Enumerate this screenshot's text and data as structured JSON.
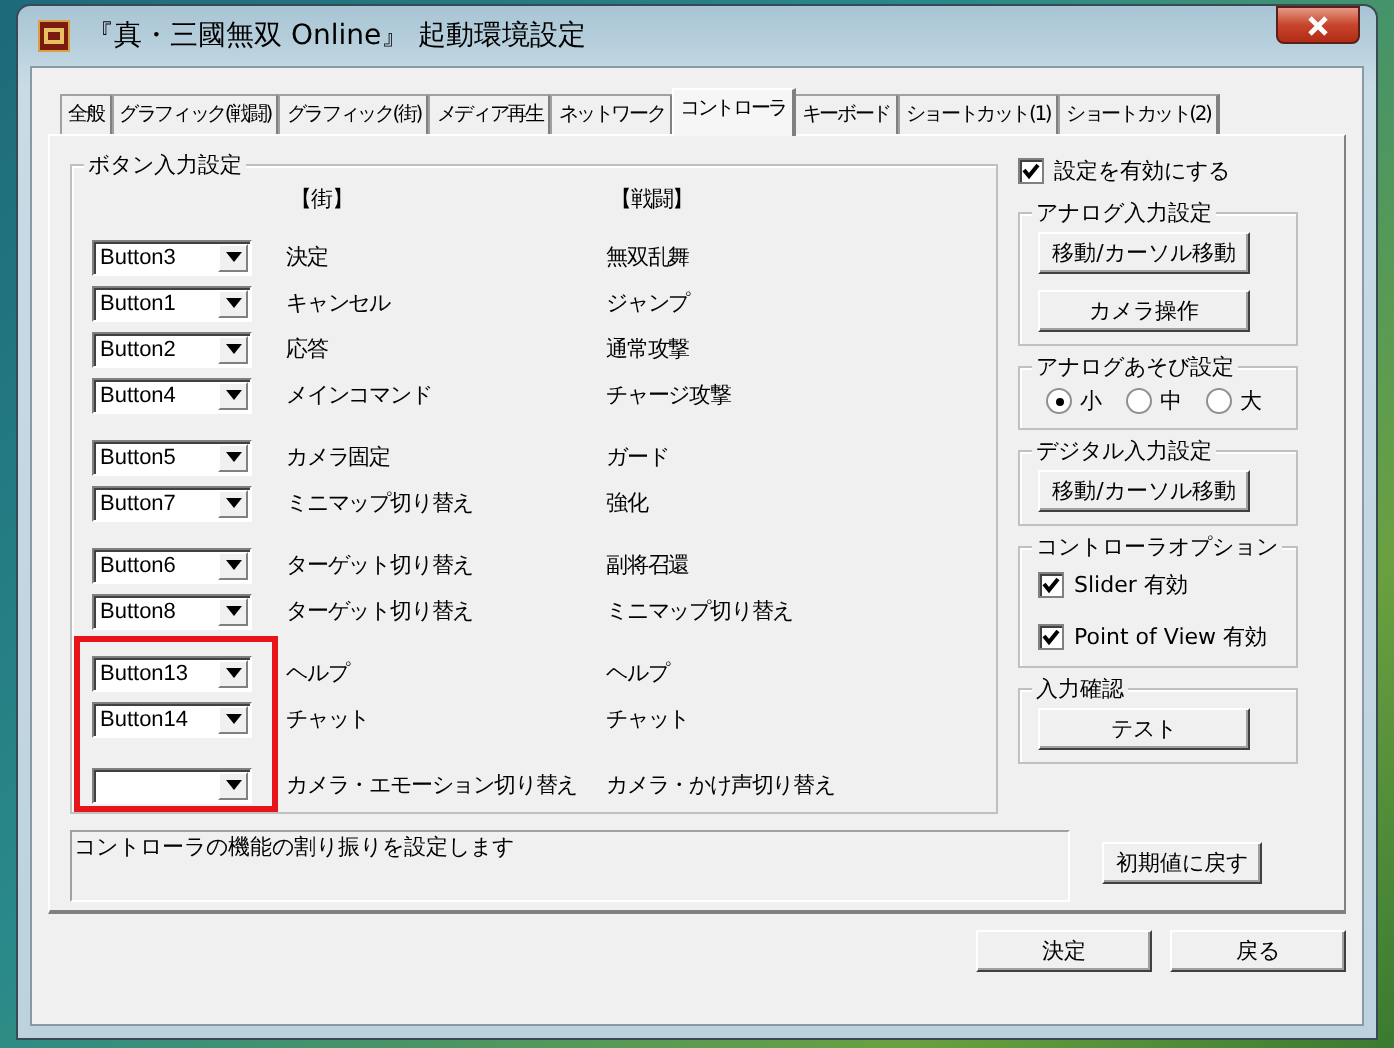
{
  "window": {
    "title": "『真・三國無双 Online』 起動環境設定"
  },
  "tabs": [
    {
      "label": "全般",
      "selected": false
    },
    {
      "label": "グラフィック(戦闘)",
      "selected": false
    },
    {
      "label": "グラフィック(街)",
      "selected": false
    },
    {
      "label": "メディア再生",
      "selected": false
    },
    {
      "label": "ネットワーク",
      "selected": false
    },
    {
      "label": "コントローラ",
      "selected": true
    },
    {
      "label": "キーボード",
      "selected": false
    },
    {
      "label": "ショートカット(1)",
      "selected": false
    },
    {
      "label": "ショートカット(2)",
      "selected": false
    }
  ],
  "button_input": {
    "title": "ボタン入力設定",
    "column_headers": [
      "【街】",
      "【戦闘】"
    ],
    "groups": [
      {
        "highlighted": false,
        "rows": [
          {
            "value": "Button3",
            "town": "決定",
            "battle": "無双乱舞"
          },
          {
            "value": "Button1",
            "town": "キャンセル",
            "battle": "ジャンプ"
          },
          {
            "value": "Button2",
            "town": "応答",
            "battle": "通常攻撃"
          },
          {
            "value": "Button4",
            "town": "メインコマンド",
            "battle": "チャージ攻撃"
          }
        ]
      },
      {
        "highlighted": false,
        "rows": [
          {
            "value": "Button5",
            "town": "カメラ固定",
            "battle": "ガード"
          },
          {
            "value": "Button7",
            "town": "ミニマップ切り替え",
            "battle": "強化"
          }
        ]
      },
      {
        "highlighted": false,
        "rows": [
          {
            "value": "Button6",
            "town": "ターゲット切り替え",
            "battle": "副将召還"
          },
          {
            "value": "Button8",
            "town": "ターゲット切り替え",
            "battle": "ミニマップ切り替え"
          }
        ]
      },
      {
        "highlighted": true,
        "rows": [
          {
            "value": "Button13",
            "town": "ヘルプ",
            "battle": "ヘルプ"
          },
          {
            "value": "Button14",
            "town": "チャット",
            "battle": "チャット"
          }
        ]
      },
      {
        "highlighted": true,
        "rows": [
          {
            "town": "カメラ・エモーション切り替え",
            "battle": "カメラ・かけ声切り替え"
          }
        ]
      }
    ]
  },
  "enable_checkbox": {
    "label": "設定を有効にする",
    "checked": true
  },
  "analog_input": {
    "title": "アナログ入力設定",
    "buttons": [
      "移動/カーソル移動",
      "カメラ操作"
    ]
  },
  "analog_play": {
    "title": "アナログあそび設定",
    "options": [
      {
        "label": "小",
        "selected": true
      },
      {
        "label": "中",
        "selected": false
      },
      {
        "label": "大",
        "selected": false
      }
    ]
  },
  "digital_input": {
    "title": "デジタル入力設定",
    "buttons": [
      "移動/カーソル移動"
    ]
  },
  "controller_options": {
    "title": "コントローラオプション",
    "checkboxes": [
      {
        "label": "Slider 有効",
        "checked": true
      },
      {
        "label": "Point of View 有効",
        "checked": true
      }
    ]
  },
  "input_check": {
    "title": "入力確認",
    "buttons": [
      "テスト"
    ]
  },
  "description": "コントローラの機能の割り振りを設定します",
  "reset_button": "初期値に戻す",
  "buttons": [
    "決定",
    "戻る"
  ]
}
